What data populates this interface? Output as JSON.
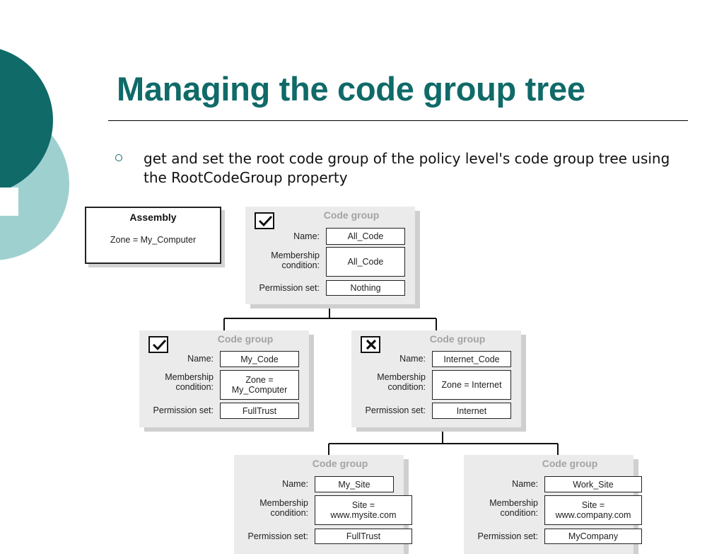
{
  "slide": {
    "title": "Managing the code group tree",
    "bullet": "get and set the root code group of the policy level's code group tree using the RootCodeGroup property"
  },
  "theme": {
    "accent": "#0f6a68",
    "accent_light": "#9fd0d0"
  },
  "diagram": {
    "assembly": {
      "title": "Assembly",
      "zone": "Zone = My_Computer"
    },
    "labels": {
      "header": "Code group",
      "name": "Name:",
      "membership_line1": "Membership",
      "membership_line2": "condition:",
      "permission": "Permission set:"
    },
    "groups": [
      {
        "name": "All_Code",
        "condition": "All_Code",
        "permission": "Nothing",
        "mark": "check"
      },
      {
        "name": "My_Code",
        "condition": "Zone = My_Computer",
        "permission": "FullTrust",
        "mark": "check"
      },
      {
        "name": "Internet_Code",
        "condition": "Zone = Internet",
        "permission": "Internet",
        "mark": "cross"
      },
      {
        "name": "My_Site",
        "condition": "Site = www.mysite.com",
        "permission": "FullTrust",
        "mark": "none"
      },
      {
        "name": "Work_Site",
        "condition": "Site = www.company.com",
        "permission": "MyCompany",
        "mark": "none"
      }
    ]
  }
}
